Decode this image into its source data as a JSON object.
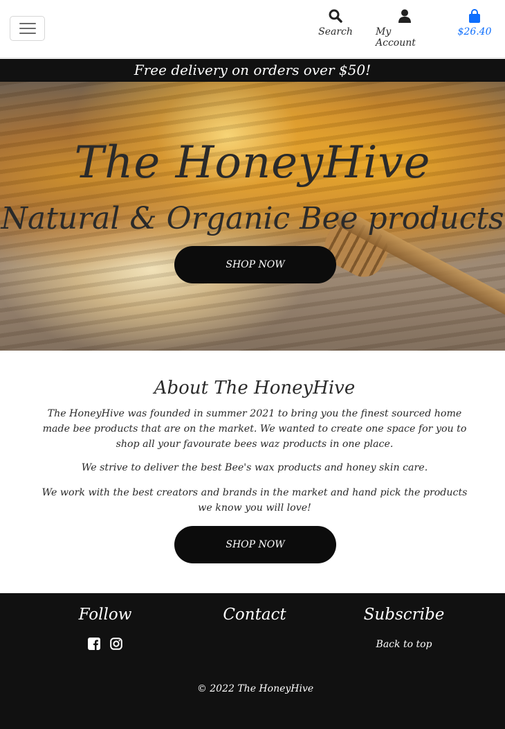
{
  "header": {
    "search_label": "Search",
    "account_label": "My Account",
    "cart_total": "$26.40",
    "cart_color": "#0d6efd"
  },
  "banner": {
    "text": "Free delivery on orders over $50!"
  },
  "hero": {
    "title": "The HoneyHive",
    "subtitle": "Natural & Organic Bee products",
    "button": "SHOP NOW"
  },
  "about": {
    "title": "About The HoneyHive",
    "paragraphs": [
      "The HoneyHive was founded in summer 2021 to bring you the finest sourced home made bee products that are on the market. We wanted to create one space for you to shop all your favourate bees waz products in one place.",
      "We strive to deliver the best Bee's wax products and honey skin care.",
      "We work with the best creators and brands in the market and hand pick the products we know you will love!"
    ],
    "button": "SHOP NOW"
  },
  "footer": {
    "follow": "Follow",
    "contact": "Contact",
    "subscribe": "Subscribe",
    "back_to_top": "Back to top",
    "copyright": "© 2022 The HoneyHive",
    "icons": [
      "facebook-icon",
      "instagram-icon"
    ]
  }
}
